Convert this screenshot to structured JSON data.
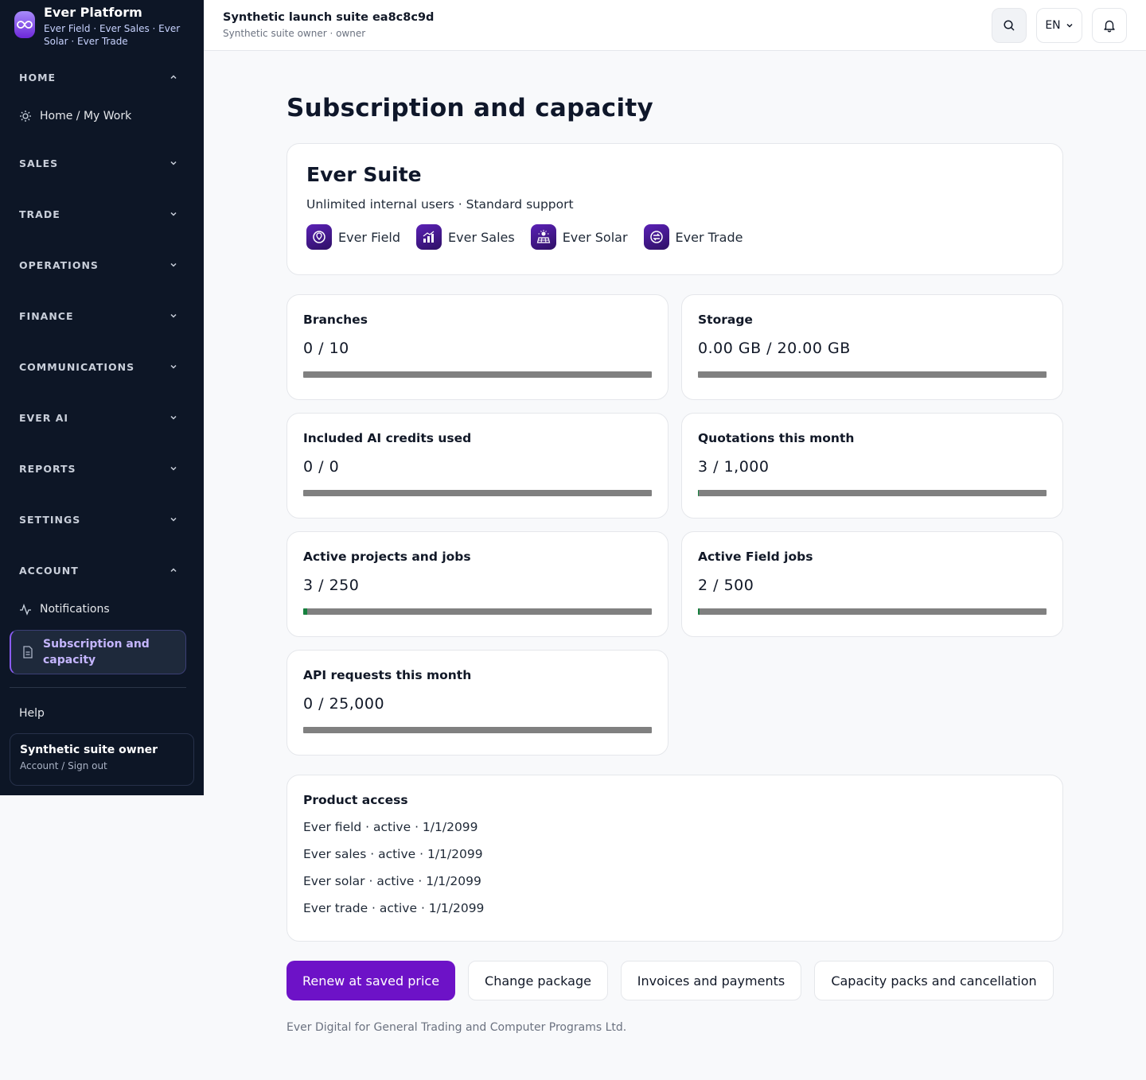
{
  "brand": {
    "title": "Ever Platform",
    "subtitle": "Ever Field · Ever Sales · Ever Solar · Ever Trade"
  },
  "sidebar": {
    "sections": {
      "home": "HOME",
      "sales": "SALES",
      "trade": "TRADE",
      "operations": "OPERATIONS",
      "finance": "FINANCE",
      "communications": "COMMUNICATIONS",
      "ever_ai": "EVER AI",
      "reports": "REPORTS",
      "settings": "SETTINGS",
      "account": "ACCOUNT"
    },
    "items": {
      "home_my_work": "Home / My Work",
      "notifications": "Notifications",
      "subscription": "Subscription and capacity"
    },
    "help": "Help",
    "user": {
      "name": "Synthetic suite owner",
      "sub": "Account / Sign out"
    }
  },
  "header": {
    "title": "Synthetic launch suite ea8c8c9d",
    "subtitle": "Synthetic suite owner · owner",
    "language": "EN"
  },
  "page": {
    "title": "Subscription and capacity"
  },
  "suite": {
    "name": "Ever Suite",
    "description": "Unlimited internal users · Standard support",
    "products": [
      "Ever Field",
      "Ever Sales",
      "Ever Solar",
      "Ever Trade"
    ]
  },
  "metrics": [
    {
      "label": "Branches",
      "value": "0 / 10",
      "fill": 0
    },
    {
      "label": "Storage",
      "value": "0.00 GB / 20.00 GB",
      "fill": 0
    },
    {
      "label": "Included AI credits used",
      "value": "0 / 0",
      "fill": 0
    },
    {
      "label": "Quotations this month",
      "value": "3 / 1,000",
      "fill": 0.003
    },
    {
      "label": "Active projects and jobs",
      "value": "3 / 250",
      "fill": 0.012
    },
    {
      "label": "Active Field jobs",
      "value": "2 / 500",
      "fill": 0.004
    },
    {
      "label": "API requests this month",
      "value": "0 / 25,000",
      "fill": 0
    }
  ],
  "access": {
    "title": "Product access",
    "lines": [
      "Ever field · active · 1/1/2099",
      "Ever sales · active · 1/1/2099",
      "Ever solar · active · 1/1/2099",
      "Ever trade · active · 1/1/2099"
    ]
  },
  "actions": {
    "renew": "Renew at saved price",
    "change": "Change package",
    "invoices": "Invoices and payments",
    "capacity": "Capacity packs and cancellation"
  },
  "footer": "Ever Digital for General Trading and Computer Programs Ltd.",
  "colors": {
    "sidebar_bg": "#0d1626",
    "accent": "#6d12c7",
    "active_text": "#c4b5fd",
    "progress_fill": "#15803d",
    "progress_track": "#808080"
  }
}
